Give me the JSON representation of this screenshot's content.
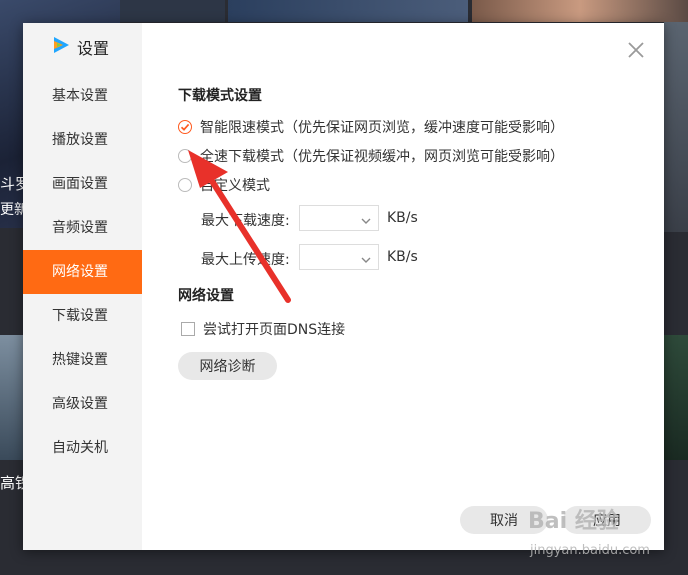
{
  "app": {
    "title": "设置"
  },
  "sidebar": {
    "items": [
      {
        "label": "基本设置",
        "active": false
      },
      {
        "label": "播放设置",
        "active": false
      },
      {
        "label": "画面设置",
        "active": false
      },
      {
        "label": "音频设置",
        "active": false
      },
      {
        "label": "网络设置",
        "active": true
      },
      {
        "label": "下载设置",
        "active": false
      },
      {
        "label": "热键设置",
        "active": false
      },
      {
        "label": "高级设置",
        "active": false
      },
      {
        "label": "自动关机",
        "active": false
      }
    ]
  },
  "download_mode": {
    "heading": "下载模式设置",
    "options": [
      {
        "label": "智能限速模式（优先保证网页浏览，缓冲速度可能受影响）",
        "selected": true
      },
      {
        "label": "全速下载模式（优先保证视频缓冲，网页浏览可能受影响）",
        "selected": false
      },
      {
        "label": "自定义模式",
        "selected": false
      }
    ],
    "max_download_label": "最大下载速度:",
    "max_upload_label": "最大上传速度:",
    "unit": "KB/s"
  },
  "network": {
    "heading": "网络设置",
    "dns_label": "尝试打开页面DNS连接",
    "dns_checked": false,
    "diagnose_button": "网络诊断"
  },
  "footer": {
    "cancel": "取消",
    "apply": "应用"
  },
  "background": {
    "text_left_1": "斗罗",
    "text_left_2": "更新",
    "text_left_3": "高铁"
  },
  "watermark": {
    "line1": "Bai 经验",
    "line2": "jingyan.baidu.com"
  },
  "colors": {
    "accent": "#ff6a13",
    "radio_selected": "#ff5a1f",
    "annotation_arrow": "#e8312a"
  },
  "icons": {
    "logo": "tencent-video-logo-icon",
    "close": "close-icon",
    "chevron": "chevron-down-icon"
  }
}
